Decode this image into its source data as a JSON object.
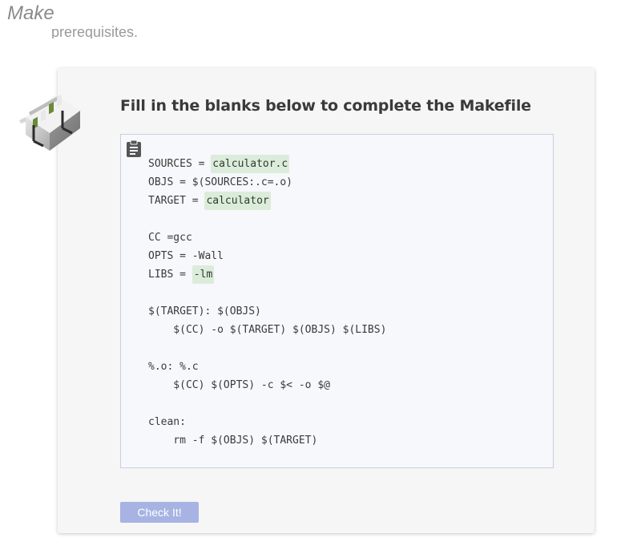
{
  "page": {
    "title": "Make",
    "cut_text": "prerequisites."
  },
  "exercise": {
    "icon": "hurdle-icon",
    "title": "Fill in the blanks below to complete the Makefile",
    "clipboard_icon": "clipboard-icon",
    "code_lines": [
      {
        "before": "SOURCES = ",
        "blank": "calculator.c",
        "after": ""
      },
      {
        "before": "OBJS = $(SOURCES:.c=.o)",
        "blank": null,
        "after": ""
      },
      {
        "before": "TARGET = ",
        "blank": "calculator",
        "after": ""
      },
      {
        "before": "",
        "blank": null,
        "after": ""
      },
      {
        "before": "CC =gcc",
        "blank": null,
        "after": ""
      },
      {
        "before": "OPTS = -Wall",
        "blank": null,
        "after": ""
      },
      {
        "before": "LIBS = ",
        "blank": "-lm",
        "after": ""
      },
      {
        "before": "",
        "blank": null,
        "after": ""
      },
      {
        "before": "$(TARGET): $(OBJS)",
        "blank": null,
        "after": ""
      },
      {
        "before": "    $(CC) -o $(TARGET) $(OBJS) $(LIBS)",
        "blank": null,
        "after": ""
      },
      {
        "before": "",
        "blank": null,
        "after": ""
      },
      {
        "before": "%.o: %.c",
        "blank": null,
        "after": ""
      },
      {
        "before": "    $(CC) $(OPTS) -c $< -o $@",
        "blank": null,
        "after": ""
      },
      {
        "before": "",
        "blank": null,
        "after": ""
      },
      {
        "before": "clean:",
        "blank": null,
        "after": ""
      },
      {
        "before": "    rm -f $(OBJS) $(TARGET)",
        "blank": null,
        "after": ""
      }
    ],
    "check_button_label": "Check It!",
    "colors": {
      "blank_highlight": "#dcecdb",
      "button": "#a7b3e2",
      "code_border": "#c9cde2"
    }
  }
}
